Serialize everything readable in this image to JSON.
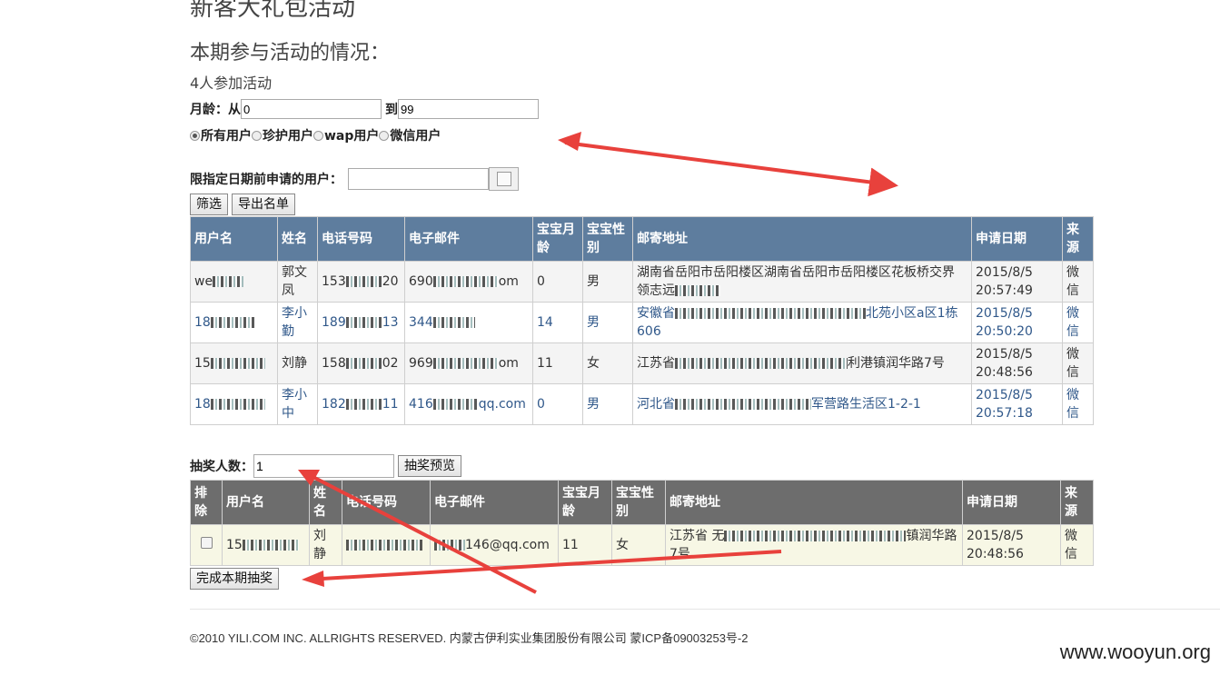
{
  "page": {
    "title": "新客大礼包活动",
    "subtitle": "本期参与活动的情况：",
    "count": "4人参加活动"
  },
  "filters": {
    "age_label": "月龄：",
    "from_label": "从",
    "from_value": "0",
    "to_label": "到",
    "to_value": "99",
    "user_types": [
      {
        "label": "所有用户",
        "checked": true
      },
      {
        "label": "珍护用户",
        "checked": false
      },
      {
        "label": "wap用户",
        "checked": false
      },
      {
        "label": "微信用户",
        "checked": false
      }
    ],
    "date_label": "限指定日期前申请的用户：",
    "date_value": "",
    "calendar_icon": "calendar-icon",
    "filter_button": "筛选",
    "export_button": "导出名单"
  },
  "applicants": {
    "headers": [
      "用户名",
      "姓名",
      "电话号码",
      "电子邮件",
      "宝宝月龄",
      "宝宝性别",
      "邮寄地址",
      "申请日期",
      "来源"
    ],
    "rows": [
      {
        "user": "we",
        "name": "郭文凤",
        "phone_a": "153",
        "phone_b": "20",
        "email_a": "690",
        "email_b": "om",
        "age": "0",
        "gender": "男",
        "addr_a": "湖南省岳阳市岳阳楼区湖南省岳阳市岳阳楼区花板桥交界",
        "addr_b": "领志远",
        "date": "2015/8/5",
        "time": "20:57:49",
        "source": "微信"
      },
      {
        "user": "18",
        "name": "李小勤",
        "phone_a": "189",
        "phone_b": "13",
        "email_a": "344",
        "email_b": "",
        "age": "14",
        "gender": "男",
        "addr_a": "安徽省",
        "addr_b": "北苑小区a区1栋606",
        "date": "2015/8/5",
        "time": "20:50:20",
        "source": "微信"
      },
      {
        "user": "15",
        "name": "刘静",
        "phone_a": "158",
        "phone_b": "02",
        "email_a": "969",
        "email_b": "om",
        "age": "11",
        "gender": "女",
        "addr_a": "江苏省",
        "addr_b": "利港镇润华路7号",
        "date": "2015/8/5",
        "time": "20:48:56",
        "source": "微信"
      },
      {
        "user": "18",
        "name": "李小中",
        "phone_a": "182",
        "phone_b": "11",
        "email_a": "416",
        "email_b": "qq.com",
        "age": "0",
        "gender": "男",
        "addr_a": "河北省",
        "addr_b": "军营路生活区1-2-1",
        "date": "2015/8/5",
        "time": "20:57:18",
        "source": "微信"
      }
    ]
  },
  "lottery": {
    "count_label": "抽奖人数：",
    "count_value": "1",
    "preview_button": "抽奖预览",
    "headers": [
      "排除",
      "用户名",
      "姓名",
      "电话号码",
      "电子邮件",
      "宝宝月龄",
      "宝宝性别",
      "邮寄地址",
      "申请日期",
      "来源"
    ],
    "row": {
      "user": "15",
      "name": "刘静",
      "phone": "",
      "email": "146@qq.com",
      "age": "11",
      "gender": "女",
      "addr_a": "江苏省 无",
      "addr_b": "镇润华路7号",
      "date": "2015/8/5",
      "time": "20:48:56",
      "source": "微信"
    },
    "finish_button": "完成本期抽奖"
  },
  "footer": "©2010 YILI.COM INC. ALLRIGHTS RESERVED. 内蒙古伊利实业集团股份有限公司 蒙ICP备09003253号-2",
  "watermark": "www.wooyun.org",
  "colors": {
    "table_header": "#5e7d9e",
    "lottery_header": "#6d6d6d",
    "annotation_arrow": "#e8413c"
  }
}
